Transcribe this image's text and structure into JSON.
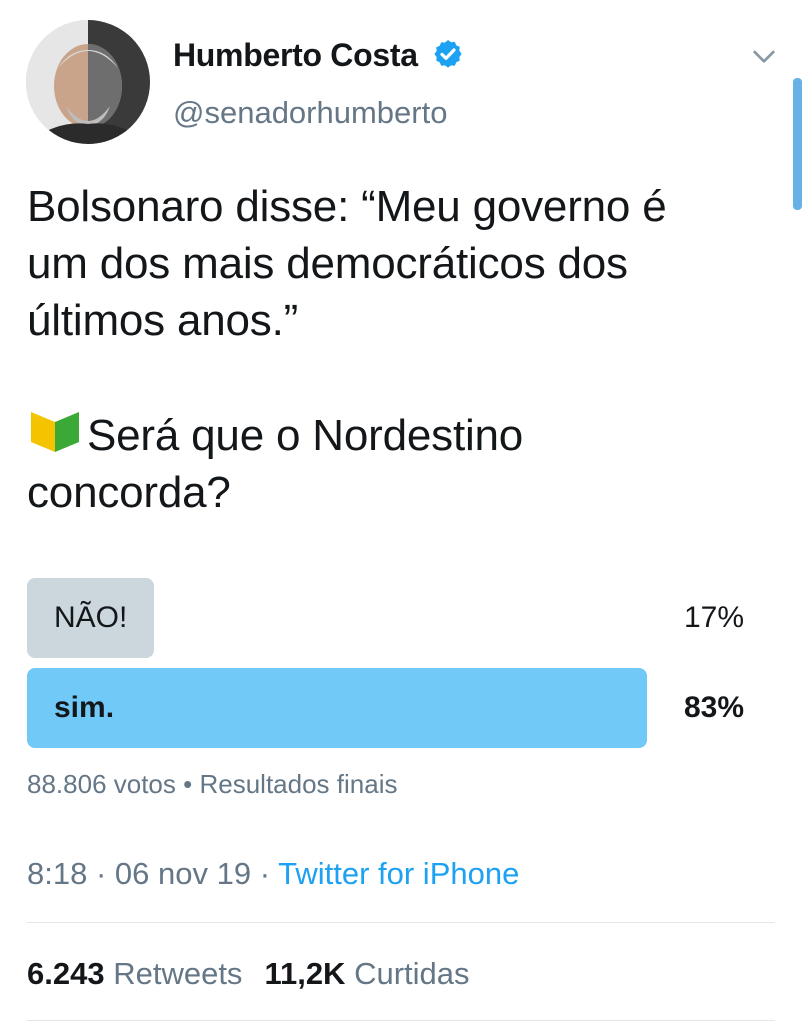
{
  "author": {
    "name": "Humberto Costa",
    "handle": "@senadorhumberto"
  },
  "tweet": {
    "line1": "Bolsonaro disse: “Meu governo é",
    "line2": "um dos mais democráticos dos",
    "line3": "últimos anos.”",
    "question1": "Será que o Nordestino",
    "question2": "concorda?"
  },
  "poll": {
    "options": [
      {
        "label": "NÃO!",
        "percent": "17%",
        "fraction": 0.17
      },
      {
        "label": "sim.",
        "percent": "83%",
        "fraction": 0.83
      }
    ],
    "votes": "88.806 votos",
    "separator": "•",
    "status": "Resultados finais"
  },
  "meta": {
    "time": "8:18",
    "dot1": "·",
    "date": "06 nov 19",
    "dot2": "·",
    "source": "Twitter for iPhone"
  },
  "stats": {
    "retweets_count": "6.243",
    "retweets_label": "Retweets",
    "likes_count": "11,2K",
    "likes_label": "Curtidas"
  },
  "icons": {
    "verified": "verified-badge-icon",
    "caret": "chevron-down-icon",
    "emoji": "beginner-leaf-icon"
  },
  "colors": {
    "accent": "#1da1f2",
    "poll_winner": "#71c9f8",
    "poll_other": "#ccd6dd",
    "muted": "#657786"
  }
}
